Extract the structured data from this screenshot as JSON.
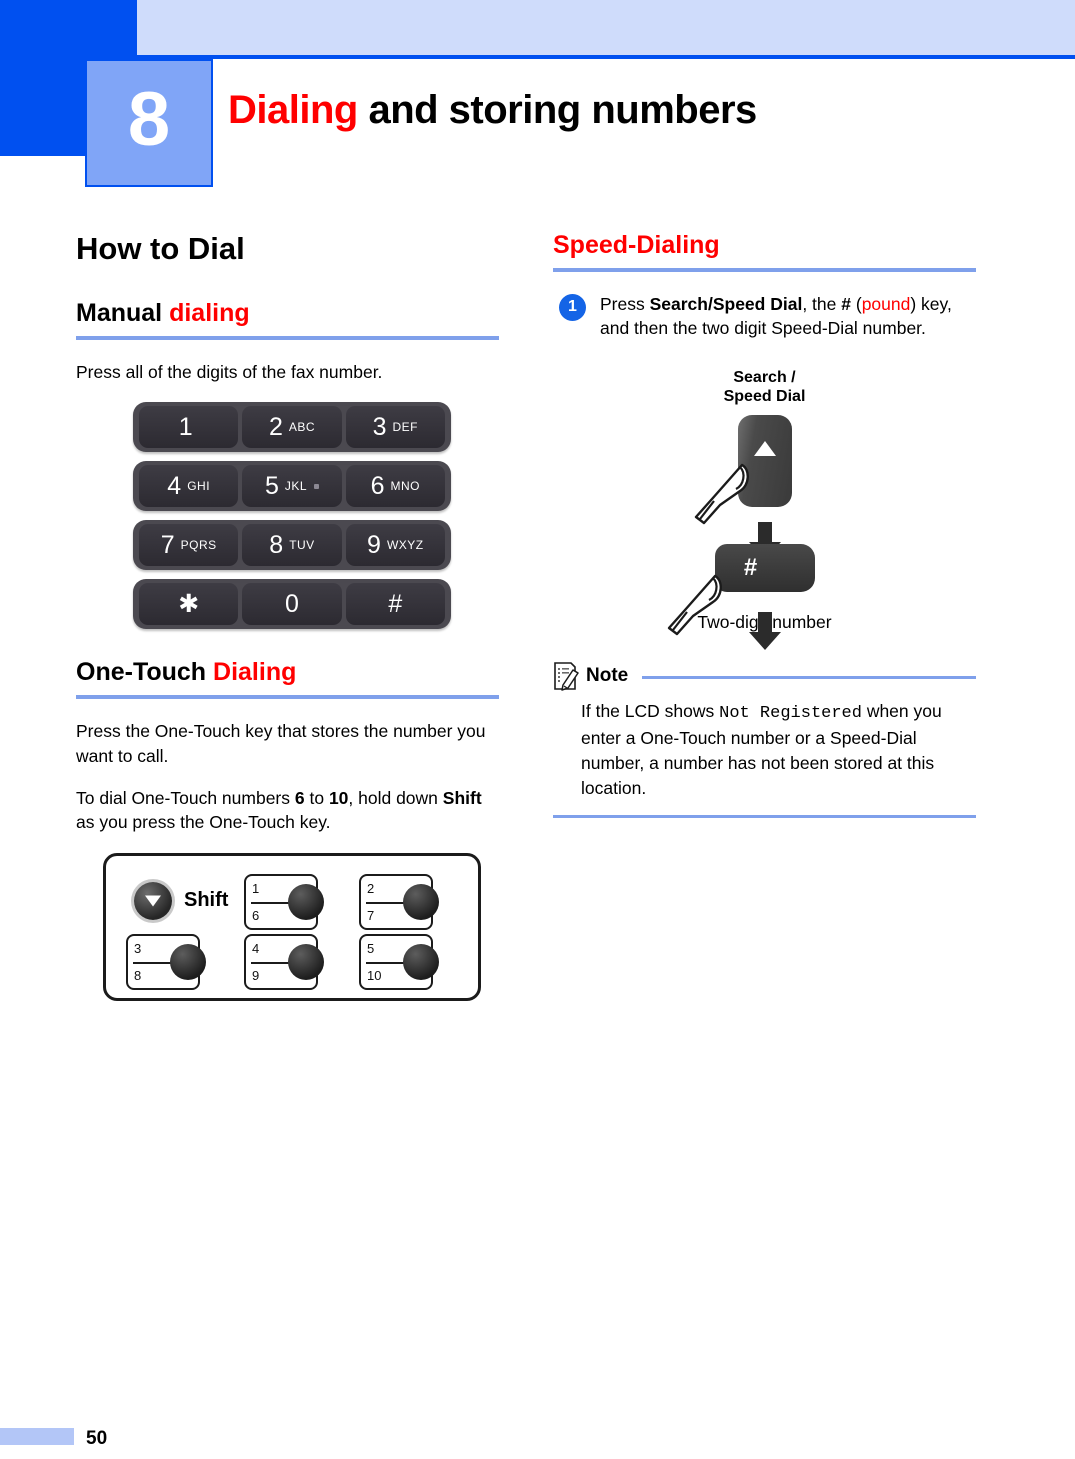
{
  "chapter": {
    "number": "8",
    "title_accent": "Dialing",
    "title_rest": " and storing numbers"
  },
  "left_column": {
    "section_title": "How to Dial",
    "manual": {
      "heading_plain": "Manual ",
      "heading_accent": "dialing",
      "paragraph": "Press all of the digits of the fax number."
    },
    "keypad": {
      "rows": [
        [
          {
            "digit": "1",
            "letters": "",
            "dot": false
          },
          {
            "digit": "2",
            "letters": "ABC",
            "dot": false
          },
          {
            "digit": "3",
            "letters": "DEF",
            "dot": false
          }
        ],
        [
          {
            "digit": "4",
            "letters": "GHI",
            "dot": false
          },
          {
            "digit": "5",
            "letters": "JKL",
            "dot": true
          },
          {
            "digit": "6",
            "letters": "MNO",
            "dot": false
          }
        ],
        [
          {
            "digit": "7",
            "letters": "PQRS",
            "dot": false
          },
          {
            "digit": "8",
            "letters": "TUV",
            "dot": false
          },
          {
            "digit": "9",
            "letters": "WXYZ",
            "dot": false
          }
        ],
        [
          {
            "digit": "✱",
            "letters": "",
            "dot": false
          },
          {
            "digit": "0",
            "letters": "",
            "dot": false
          },
          {
            "digit": "#",
            "letters": "",
            "dot": false
          }
        ]
      ]
    },
    "onetouch": {
      "heading_plain": "One-Touch ",
      "heading_accent": "Dialing",
      "paragraph1": "Press the One-Touch key that stores the number you want to call.",
      "paragraph2_pre": "To dial One-Touch numbers ",
      "paragraph2_b1": "6",
      "paragraph2_mid": " to ",
      "paragraph2_b2": "10",
      "paragraph2_mid2": ", hold down ",
      "paragraph2_b3": "Shift",
      "paragraph2_post": " as you press the One-Touch key.",
      "shift_label": "Shift",
      "keys": [
        {
          "top": "1",
          "bottom": "6"
        },
        {
          "top": "2",
          "bottom": "7"
        },
        {
          "top": "3",
          "bottom": "8"
        },
        {
          "top": "4",
          "bottom": "9"
        },
        {
          "top": "5",
          "bottom": "10"
        }
      ]
    }
  },
  "right_column": {
    "section_title": "Speed-Dialing",
    "step": {
      "number": "1",
      "text_pre": "Press ",
      "text_b1": "Search/Speed Dial",
      "text_mid": ", the ",
      "text_b2": "#",
      "text_paren_open": " (",
      "text_accent": "pound",
      "text_paren_close": ") key, and then the two digit Speed-Dial number."
    },
    "figure": {
      "caption_line1": "Search /",
      "caption_line2": "Speed Dial",
      "hash_key_label": "#",
      "bottom_label": "Two-digit number"
    },
    "note": {
      "title": "Note",
      "body_pre": "If the LCD shows ",
      "body_mono": "Not Registered",
      "body_post": " when you enter a One-Touch number or a Speed-Dial number, a number has not been stored at this location."
    }
  },
  "footer": {
    "page_number": "50"
  }
}
